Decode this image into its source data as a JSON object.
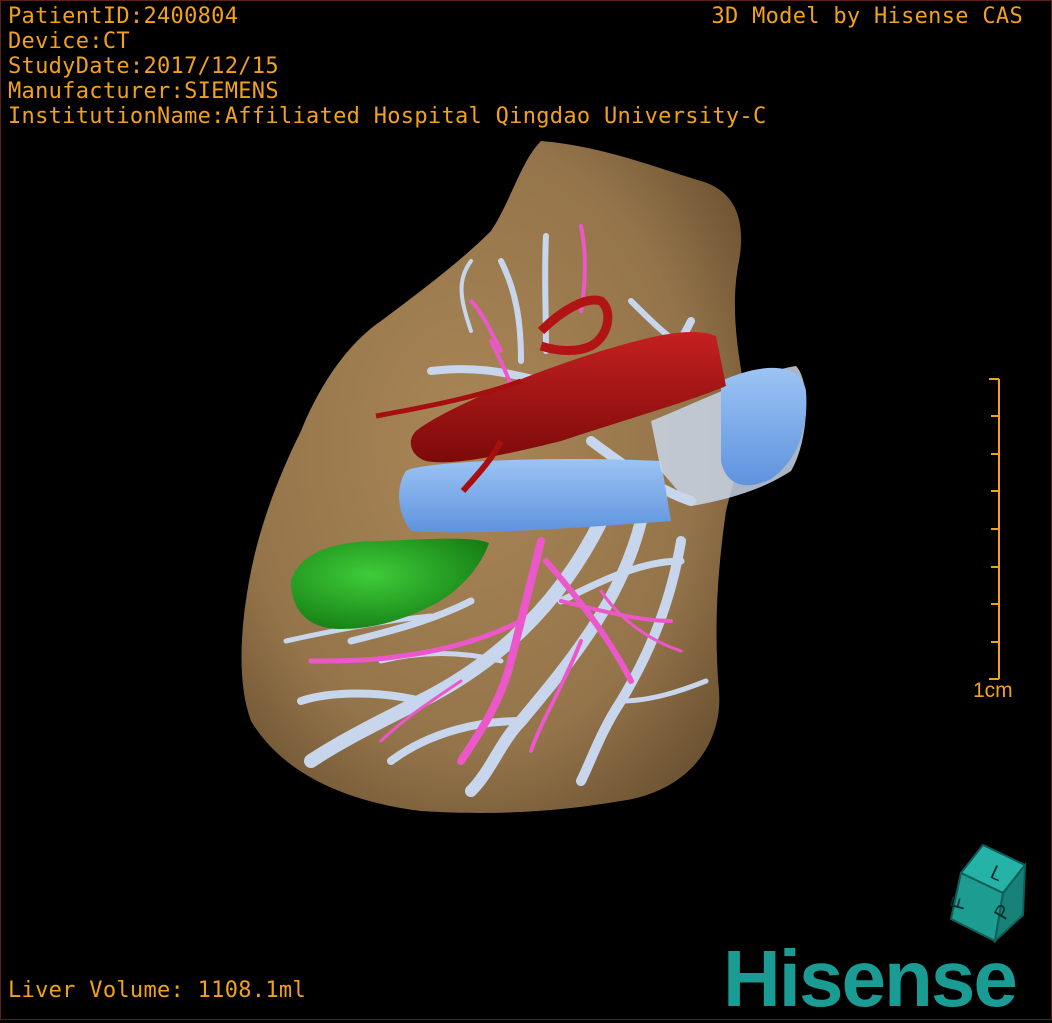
{
  "header": {
    "patient_id": "PatientID:2400804",
    "device": "Device:CT",
    "study_date": "StudyDate:2017/12/15",
    "manufacturer": "Manufacturer:SIEMENS",
    "institution": "InstitutionName:Affiliated Hospital Qingdao University-C"
  },
  "brand_text": "3D Model by Hisense CAS",
  "footer": {
    "liver_volume": "Liver Volume: 1108.1ml"
  },
  "scale_bar": {
    "label": "1cm"
  },
  "logo": {
    "text": "Hisense"
  },
  "orientation_cube": {
    "faces": [
      "L",
      "P",
      "F"
    ]
  },
  "colors": {
    "overlay_text": "#f2a11c",
    "liver": "#9a7a4f",
    "portal_vein": "#7fb0ec",
    "hepatic_vessels_pale": "#c7d6ec",
    "artery": "#a50f0f",
    "biliary": "#ec58c9",
    "gallbladder": "#20a81e",
    "logo": "#1a9b93"
  },
  "icons": [
    "orientation-cube-icon",
    "scale-bar-icon"
  ]
}
